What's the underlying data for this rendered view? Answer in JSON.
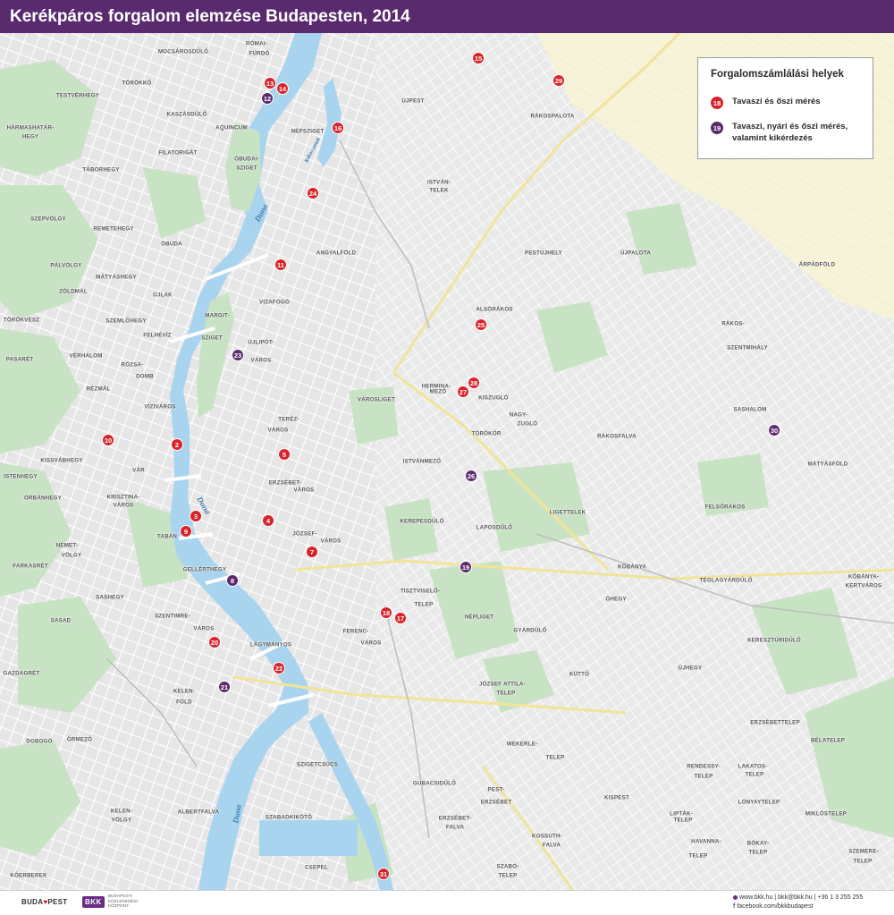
{
  "title": "Kerékpáros forgalom elemzése Budapesten, 2014",
  "legend": {
    "title": "Forgalomszámlálási helyek",
    "spring_autumn": {
      "marker": "18",
      "color": "#d8232a",
      "label": "Tavaszi és őszi mérés"
    },
    "spring_summer_autumn": {
      "marker": "19",
      "color": "#5b2a6e",
      "label_line1": "Tavaszi, nyári és őszi mérés,",
      "label_line2": "valamint kikérdezés"
    }
  },
  "colors": {
    "red_marker": "#d8232a",
    "purple_marker": "#5b2a6e",
    "water": "#a8d4ef",
    "park": "#c8e3c4",
    "street": "#ffffff",
    "land": "#ededed",
    "fields": "#f7f3d9",
    "title_bg": "#5a2a6e"
  },
  "markers": [
    {
      "id": "m2",
      "label": "2",
      "type": "red"
    },
    {
      "id": "m3",
      "label": "3",
      "type": "red"
    },
    {
      "id": "m4",
      "label": "4",
      "type": "red"
    },
    {
      "id": "m5",
      "label": "5",
      "type": "red"
    },
    {
      "id": "m7",
      "label": "7",
      "type": "red"
    },
    {
      "id": "m8",
      "label": "8",
      "type": "purple"
    },
    {
      "id": "m9",
      "label": "9",
      "type": "red"
    },
    {
      "id": "m10",
      "label": "10",
      "type": "red"
    },
    {
      "id": "m11",
      "label": "11",
      "type": "red"
    },
    {
      "id": "m12",
      "label": "12",
      "type": "purple"
    },
    {
      "id": "m13",
      "label": "13",
      "type": "red"
    },
    {
      "id": "m14",
      "label": "14",
      "type": "red"
    },
    {
      "id": "m15",
      "label": "15",
      "type": "red"
    },
    {
      "id": "m16",
      "label": "16",
      "type": "red"
    },
    {
      "id": "m17",
      "label": "17",
      "type": "red"
    },
    {
      "id": "m18",
      "label": "18",
      "type": "red"
    },
    {
      "id": "m19",
      "label": "19",
      "type": "purple"
    },
    {
      "id": "m20",
      "label": "20",
      "type": "red"
    },
    {
      "id": "m21",
      "label": "21",
      "type": "purple"
    },
    {
      "id": "m22",
      "label": "22",
      "type": "red"
    },
    {
      "id": "m23",
      "label": "23",
      "type": "purple"
    },
    {
      "id": "m24",
      "label": "24",
      "type": "red"
    },
    {
      "id": "m25",
      "label": "25",
      "type": "red"
    },
    {
      "id": "m26",
      "label": "26",
      "type": "purple"
    },
    {
      "id": "m27",
      "label": "27",
      "type": "red"
    },
    {
      "id": "m28",
      "label": "28",
      "type": "red"
    },
    {
      "id": "m29",
      "label": "29",
      "type": "red"
    },
    {
      "id": "m30",
      "label": "30",
      "type": "purple"
    },
    {
      "id": "m31",
      "label": "31",
      "type": "red"
    }
  ],
  "places": [
    {
      "id": "romai_furdo_1",
      "text": "RÓMAI-"
    },
    {
      "id": "romai_furdo_2",
      "text": "FÜRDŐ"
    },
    {
      "id": "mocsarosdulo",
      "text": "MOCSÁROSDŰLŐ"
    },
    {
      "id": "torokko",
      "text": "TÖRÖKKŐ"
    },
    {
      "id": "testvérhegy",
      "text": "TESTVÉRHEGY"
    },
    {
      "id": "kaszasdulo",
      "text": "KASZÁSDŰLŐ"
    },
    {
      "id": "aquincum",
      "text": "AQUINCUM"
    },
    {
      "id": "harmashatar_1",
      "text": "HÁRMASHATÁR-"
    },
    {
      "id": "harmashatar_2",
      "text": "HEGY"
    },
    {
      "id": "filatorigat",
      "text": "FILATORIGÁT"
    },
    {
      "id": "obudai_1",
      "text": "ÓBUDAI-"
    },
    {
      "id": "obudai_2",
      "text": "SZIGET"
    },
    {
      "id": "taborhegy",
      "text": "TÁBORHEGY"
    },
    {
      "id": "szepvolgy",
      "text": "SZÉPVÖLGY"
    },
    {
      "id": "remetehegy",
      "text": "REMETEHEGY"
    },
    {
      "id": "obuda",
      "text": "ÓBUDA"
    },
    {
      "id": "palvolgy",
      "text": "PÁLVÖLGY"
    },
    {
      "id": "matyashegy",
      "text": "MÁTYÁSHEGY"
    },
    {
      "id": "zoldmal",
      "text": "ZÖLDMÁL"
    },
    {
      "id": "ujlak",
      "text": "ÚJLAK"
    },
    {
      "id": "torokves",
      "text": "TÖRÖKVÉSZ"
    },
    {
      "id": "szemlohegy",
      "text": "SZEMLŐHEGY"
    },
    {
      "id": "felhevíz",
      "text": "FELHÉVÍZ"
    },
    {
      "id": "pasaret",
      "text": "PASARÉT"
    },
    {
      "id": "verhalom",
      "text": "VÉRHALOM"
    },
    {
      "id": "rozsadomb_1",
      "text": "RÓZSA-"
    },
    {
      "id": "rozsadomb_2",
      "text": "DOMB"
    },
    {
      "id": "rezmal",
      "text": "RÉZMÁL"
    },
    {
      "id": "margit_1",
      "text": "MARGIT-"
    },
    {
      "id": "margit_2",
      "text": "SZIGET"
    },
    {
      "id": "vizivaros",
      "text": "VÍZIVÁROS"
    },
    {
      "id": "kissvabhegy",
      "text": "KISSVÁBHEGY"
    },
    {
      "id": "istenhegy",
      "text": "ISTENHEGY"
    },
    {
      "id": "var",
      "text": "VÁR"
    },
    {
      "id": "orbanhegy",
      "text": "ORBÁNHEGY"
    },
    {
      "id": "krisztina_1",
      "text": "KRISZTINA-"
    },
    {
      "id": "krisztina_2",
      "text": "VÁROS"
    },
    {
      "id": "tabán",
      "text": "TABÁN"
    },
    {
      "id": "nemetvolgy_1",
      "text": "NÉMET-"
    },
    {
      "id": "nemetvolgy_2",
      "text": "VÖLGY"
    },
    {
      "id": "farkasret",
      "text": "FARKASRÉT"
    },
    {
      "id": "gellerthegy",
      "text": "GELLÉRTHEGY"
    },
    {
      "id": "sashegy",
      "text": "SASHEGY"
    },
    {
      "id": "sasad",
      "text": "SASAD"
    },
    {
      "id": "szentimre_1",
      "text": "SZENTIMRE-"
    },
    {
      "id": "szentimre_2",
      "text": "VÁROS"
    },
    {
      "id": "lagymanyos",
      "text": "LÁGYMÁNYOS"
    },
    {
      "id": "gazdagret",
      "text": "GAZDAGRÉT"
    },
    {
      "id": "kelenfold_1",
      "text": "KELEN-"
    },
    {
      "id": "kelenfold_2",
      "text": "FÖLD"
    },
    {
      "id": "ormezo",
      "text": "ŐRMEZŐ"
    },
    {
      "id": "dobogo",
      "text": "DOBOGÓ"
    },
    {
      "id": "kelenvolgy_1",
      "text": "KELEN-"
    },
    {
      "id": "kelenvolgy_2",
      "text": "VÖLGY"
    },
    {
      "id": "albertfalva",
      "text": "ALBERTFALVA"
    },
    {
      "id": "kobanya_berek",
      "text": "KŐERBEREK"
    },
    {
      "id": "csepel",
      "text": "CSEPEL"
    },
    {
      "id": "szabadkikoto",
      "text": "SZABADKIKÖTŐ"
    },
    {
      "id": "szigetcsucs",
      "text": "SZIGETCSÚCS"
    },
    {
      "id": "gubacsidulo",
      "text": "GUBACSIDŰLŐ"
    },
    {
      "id": "pesterzsebet_1",
      "text": "PEST-"
    },
    {
      "id": "pesterzsebet_2",
      "text": "ERZSÉBET"
    },
    {
      "id": "erzsebetfalva_1",
      "text": "ERZSÉBET-"
    },
    {
      "id": "erzsebetfalva_2",
      "text": "FALVA"
    },
    {
      "id": "kossuthfalva_1",
      "text": "KOSSUTH-"
    },
    {
      "id": "kossuthfalva_2",
      "text": "FALVA"
    },
    {
      "id": "szabotelep_1",
      "text": "SZABÓ-"
    },
    {
      "id": "szabotelep_2",
      "text": "TELEP"
    },
    {
      "id": "ujpest",
      "text": "ÚJPEST"
    },
    {
      "id": "nepsziget",
      "text": "NÉPSZIGET"
    },
    {
      "id": "istvantelek_1",
      "text": "ISTVÁN-"
    },
    {
      "id": "istvantelek_2",
      "text": "TELEK"
    },
    {
      "id": "rakospalota",
      "text": "RÁKOSPALOTA"
    },
    {
      "id": "angyalfold",
      "text": "ANGYALFÖLD"
    },
    {
      "id": "pestujhely",
      "text": "PESTÚJHELY"
    },
    {
      "id": "ujpalota",
      "text": "ÚJPALOTA"
    },
    {
      "id": "arpadfold",
      "text": "ÁRPÁDFÖLD"
    },
    {
      "id": "vizafogo",
      "text": "VIZAFOGÓ"
    },
    {
      "id": "ujlipotvaros_1",
      "text": "ÚJLIPÓT-"
    },
    {
      "id": "ujlipotvaros_2",
      "text": "VÁROS"
    },
    {
      "id": "alsorakos",
      "text": "ALSÓRÁKOS"
    },
    {
      "id": "rakosszentmihaly_1",
      "text": "RÁKOS-"
    },
    {
      "id": "rakosszentmihaly_2",
      "text": "SZENTMIHÁLY"
    },
    {
      "id": "herminamezo_1",
      "text": "HERMINA-"
    },
    {
      "id": "herminamezo_2",
      "text": "MEZŐ"
    },
    {
      "id": "kiszuglo",
      "text": "KISZUGLÓ"
    },
    {
      "id": "varosliget",
      "text": "VÁROSLIGET"
    },
    {
      "id": "nagyzuglo_1",
      "text": "NAGY-"
    },
    {
      "id": "nagyzuglo_2",
      "text": "ZUGLÓ"
    },
    {
      "id": "terezvaros_1",
      "text": "TERÉZ-"
    },
    {
      "id": "terezvaros_2",
      "text": "VÁROS"
    },
    {
      "id": "torokor",
      "text": "TÖRÖKŐR"
    },
    {
      "id": "rakosfalva",
      "text": "RÁKOSFALVA"
    },
    {
      "id": "sashalom",
      "text": "SASHALOM"
    },
    {
      "id": "istvanmezo",
      "text": "ISTVÁNMEZŐ"
    },
    {
      "id": "erzsebetvaros_1",
      "text": "ERZSÉBET-"
    },
    {
      "id": "erzsebetvaros_2",
      "text": "VÁROS"
    },
    {
      "id": "matyasfold",
      "text": "MÁTYÁSFÖLD"
    },
    {
      "id": "felsorakos",
      "text": "FELSŐRÁKOS"
    },
    {
      "id": "kerepesdulo",
      "text": "KEREPESDŰLŐ"
    },
    {
      "id": "laposdulo",
      "text": "LAPOSDŰLŐ"
    },
    {
      "id": "ligettelek",
      "text": "LIGETTELEK"
    },
    {
      "id": "jozsefvaros_1",
      "text": "JÓZSEF-"
    },
    {
      "id": "jozsefvaros_2",
      "text": "VÁROS"
    },
    {
      "id": "kobanya",
      "text": "KŐBÁNYA"
    },
    {
      "id": "kobanyakertvaros_1",
      "text": "KŐBÁNYA-"
    },
    {
      "id": "kobanyakertvaros_2",
      "text": "KERTVÁROS"
    },
    {
      "id": "ohegy",
      "text": "ÓHEGY"
    },
    {
      "id": "teglagyardulo",
      "text": "TÉGLAGYÁRDŰLŐ"
    },
    {
      "id": "tisztviselotelep_1",
      "text": "TISZTVISELŐ-"
    },
    {
      "id": "tisztviselotelep_2",
      "text": "TELEP"
    },
    {
      "id": "nepliget",
      "text": "NÉPLIGET"
    },
    {
      "id": "ferencvaros_1",
      "text": "FERENC-"
    },
    {
      "id": "ferencvaros_2",
      "text": "VÁROS"
    },
    {
      "id": "gyarudulo",
      "text": "GYÁRDŰLŐ"
    },
    {
      "id": "keresztursdulo",
      "text": "KERESZTÚRIDŰLŐ"
    },
    {
      "id": "ujhegy",
      "text": "ÚJHEGY"
    },
    {
      "id": "kutto",
      "text": "KÜTTŐ"
    },
    {
      "id": "jozsefattilatelep_1",
      "text": "JÓZSEF ATTILA-"
    },
    {
      "id": "jozsefattilatelep_2",
      "text": "TELEP"
    },
    {
      "id": "erzsebettelep",
      "text": "ERZSÉBETTELEP"
    },
    {
      "id": "belatelep",
      "text": "BÉLATELEP"
    },
    {
      "id": "wekerletelep_1",
      "text": "WEKERLE-"
    },
    {
      "id": "wekerletelep_2",
      "text": "TELEP"
    },
    {
      "id": "rendessytelep_1",
      "text": "RENDESSY-"
    },
    {
      "id": "rendessytelep_2",
      "text": "TELEP"
    },
    {
      "id": "lakatostelep_1",
      "text": "LAKATOS-"
    },
    {
      "id": "lakatostelep_2",
      "text": "TELEP"
    },
    {
      "id": "kispest",
      "text": "KISPEST"
    },
    {
      "id": "lonyaytelep",
      "text": "LÓNYAYTELEP"
    },
    {
      "id": "miklostelep",
      "text": "MIKLÓSTELEP"
    },
    {
      "id": "liptaktelep_1",
      "text": "LIPTÁK-"
    },
    {
      "id": "liptaktelep_2",
      "text": "TELEP"
    },
    {
      "id": "havannatelep_1",
      "text": "HAVANNA-"
    },
    {
      "id": "havannatelep_2",
      "text": "TELEP"
    },
    {
      "id": "bokaytelep_1",
      "text": "BÓKAY-"
    },
    {
      "id": "bokaytelep_2",
      "text": "TELEP"
    },
    {
      "id": "szemeretelep_1",
      "text": "SZEMERE-"
    },
    {
      "id": "szemeretelep_2",
      "text": "TELEP"
    }
  ],
  "water_labels": [
    {
      "id": "duna_1",
      "text": "Duna"
    },
    {
      "id": "duna_2",
      "text": "Duna"
    },
    {
      "id": "duna_3",
      "text": "Duna"
    },
    {
      "id": "rakpart_1",
      "text": "Rákos-patak"
    }
  ],
  "footer": {
    "budapest_logo_a": "BUDA",
    "budapest_logo_b": "PEST",
    "bkk_logo": "BKK",
    "bkk_sub": "BUDAPESTI KÖZLEKEDÉSI KÖZPONT",
    "web": "www.bkk.hu",
    "email": "bkk@bkk.hu",
    "phone": "+36 1 3 255 255",
    "facebook": "facebook.com/bkkbudapest"
  }
}
